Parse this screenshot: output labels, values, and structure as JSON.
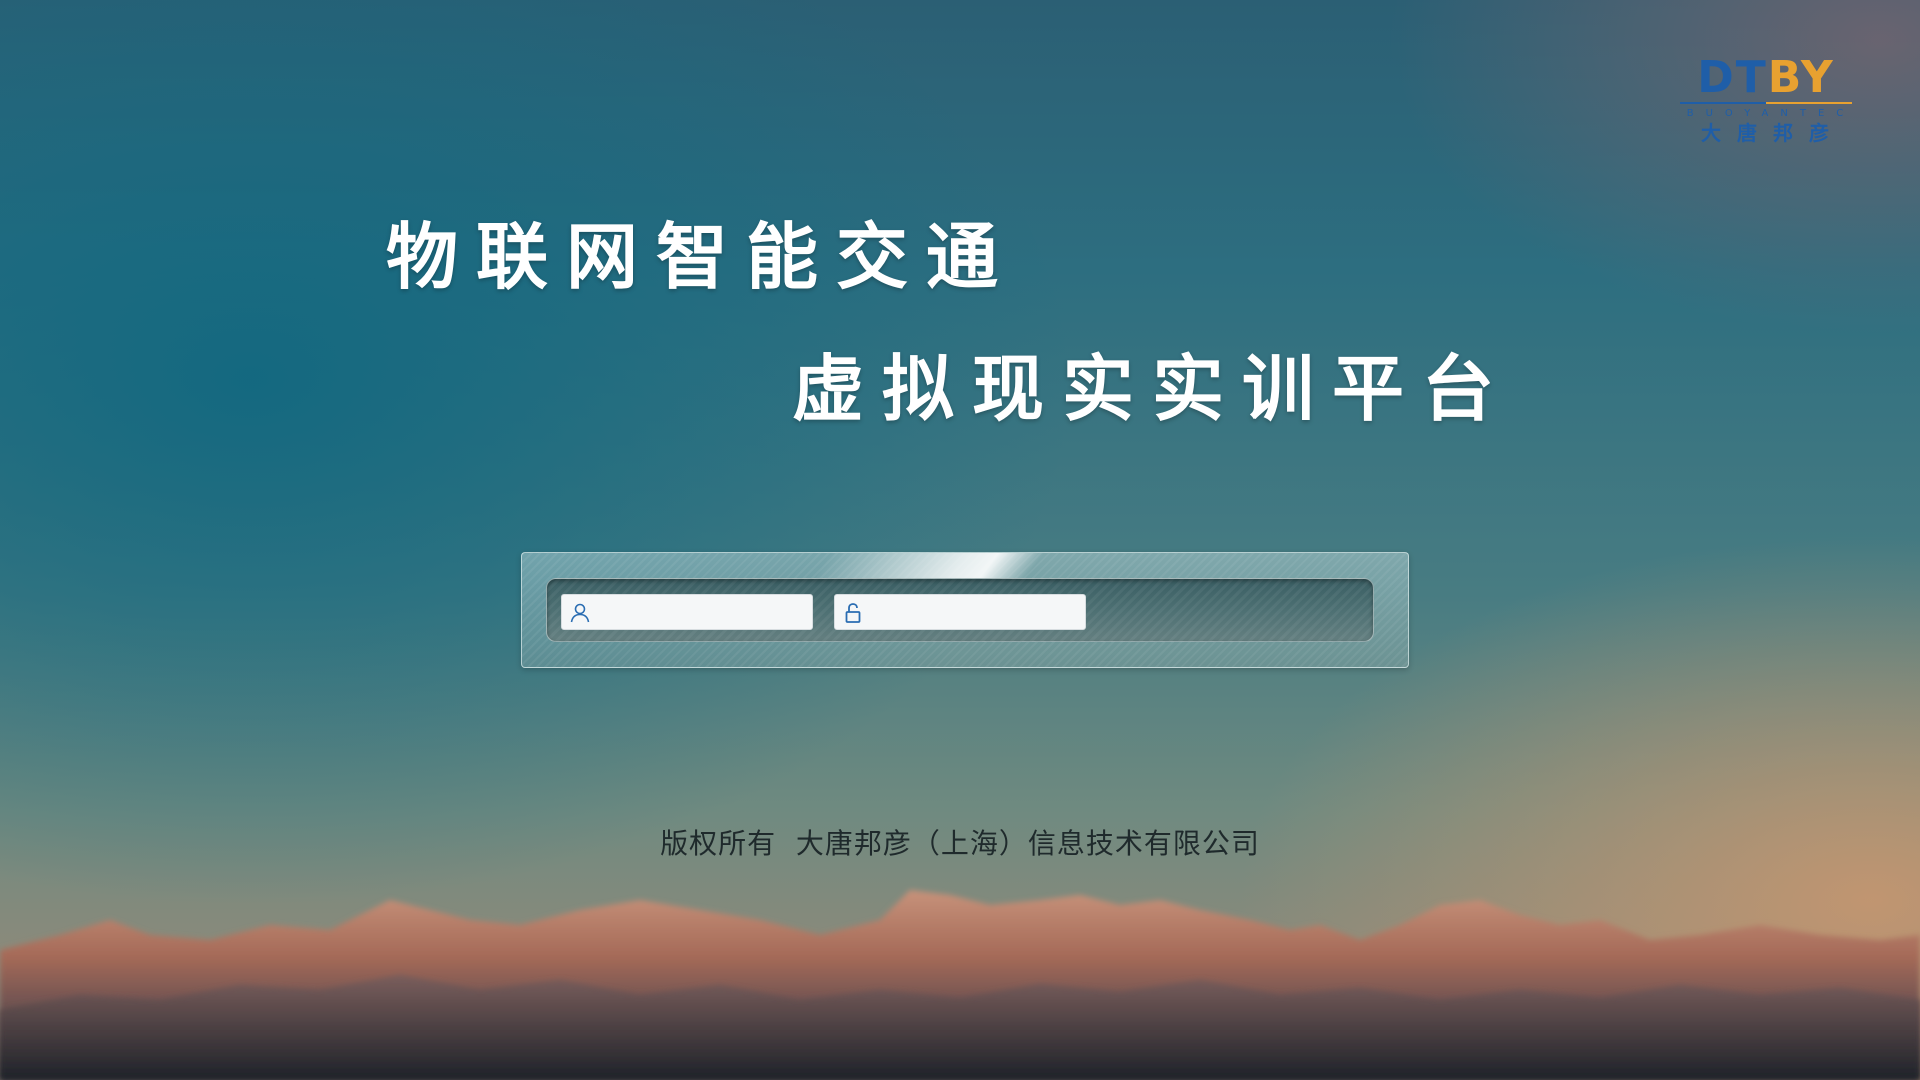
{
  "logo": {
    "mark_left": "DT",
    "mark_right": "BY",
    "sub": "BUOYANTEC",
    "cn": "大唐邦彦",
    "color_blue": "#1f5ea8",
    "color_orange": "#e8a130"
  },
  "title": {
    "line1": "物联网智能交通",
    "line2": "虚拟现实实训平台"
  },
  "login": {
    "username": {
      "icon": "user-icon",
      "value": "",
      "placeholder": ""
    },
    "password": {
      "icon": "unlock-icon",
      "value": "",
      "placeholder": ""
    }
  },
  "footer": {
    "copyright": "版权所有  大唐邦彦（上海）信息技术有限公司"
  }
}
